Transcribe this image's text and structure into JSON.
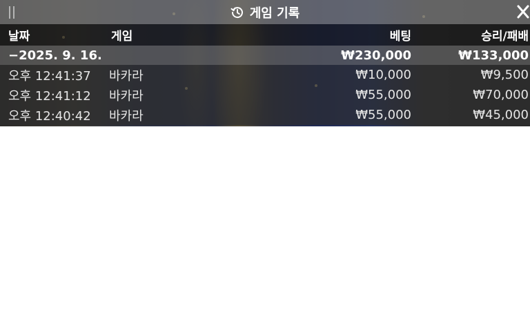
{
  "panel": {
    "title": "게임 기록",
    "icons": {
      "drag": "drag-handle-icon",
      "title": "history-icon",
      "close": "close-icon"
    }
  },
  "table": {
    "columns": {
      "date": "날짜",
      "game": "게임",
      "bet": "베팅",
      "result": "승리/패배"
    },
    "summary": {
      "date": "−2025. 9. 16.",
      "game": "",
      "bet": "₩230,000",
      "result": "₩133,000"
    },
    "rows": [
      {
        "time": "오후 12:41:37",
        "game": "바카라",
        "bet": "₩10,000",
        "result": "₩9,500"
      },
      {
        "time": "오후 12:41:12",
        "game": "바카라",
        "bet": "₩55,000",
        "result": "₩70,000"
      },
      {
        "time": "오후 12:40:42",
        "game": "바카라",
        "bet": "₩55,000",
        "result": "₩45,000"
      }
    ]
  },
  "colors": {
    "text": "#ffffff",
    "titlebar": "#787878",
    "header": "#141414"
  }
}
